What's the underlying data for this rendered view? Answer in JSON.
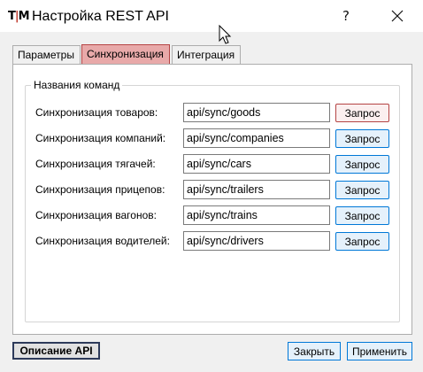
{
  "window": {
    "app_icon_left": "T",
    "app_icon_sep": "|",
    "app_icon_right": "M",
    "title": "Настройка REST API",
    "help_label": "?",
    "close_icon": "close-icon"
  },
  "tabs": [
    {
      "label": "Параметры",
      "active": false
    },
    {
      "label": "Синхронизация",
      "active": true
    },
    {
      "label": "Интеграция",
      "active": false
    }
  ],
  "group": {
    "title": "Названия команд",
    "rows": [
      {
        "label": "Синхронизация товаров:",
        "value": "api/sync/goods",
        "button": "Запрос"
      },
      {
        "label": "Синхронизация компаний:",
        "value": "api/sync/companies",
        "button": "Запрос"
      },
      {
        "label": "Синхронизация тягачей:",
        "value": "api/sync/cars",
        "button": "Запрос"
      },
      {
        "label": "Синхронизация прицепов:",
        "value": "api/sync/trailers",
        "button": "Запрос"
      },
      {
        "label": "Синхронизация вагонов:",
        "value": "api/sync/trains",
        "button": "Запрос"
      },
      {
        "label": "Синхронизация водителей:",
        "value": "api/sync/drivers",
        "button": "Запрос"
      }
    ]
  },
  "footer": {
    "description_button": "Описание API",
    "close_button": "Закрыть",
    "apply_button": "Применить"
  },
  "colors": {
    "active_tab_bg": "#e8a9a9",
    "active_tab_border": "#b54444",
    "button_border": "#0078d7",
    "button_bg": "#e5f1fb"
  }
}
